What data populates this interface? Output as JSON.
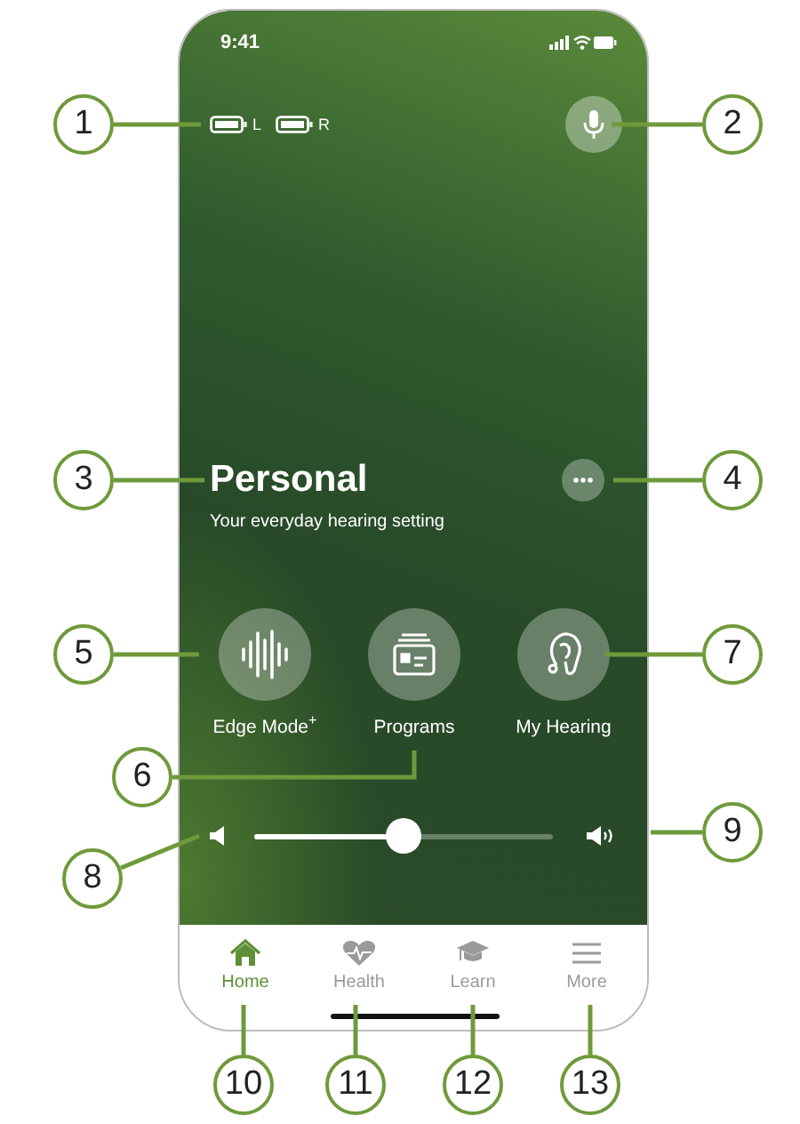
{
  "callouts": [
    "1",
    "2",
    "3",
    "4",
    "5",
    "6",
    "7",
    "8",
    "9",
    "10",
    "11",
    "12",
    "13"
  ],
  "status_bar": {
    "time": "9:41"
  },
  "hearing_aids": [
    {
      "side": "L"
    },
    {
      "side": "R"
    }
  ],
  "program": {
    "title": "Personal",
    "subtitle": "Your everyday hearing setting"
  },
  "actions": [
    {
      "kind": "edge",
      "label": "Edge Mode$^{+}$"
    },
    {
      "kind": "programs",
      "label": "Programs"
    },
    {
      "kind": "hearing",
      "label": "My Hearing"
    }
  ],
  "volume": {
    "level": 0.5
  },
  "tabs": [
    {
      "kind": "home",
      "label": "Home",
      "selected": true
    },
    {
      "kind": "health",
      "label": "Health",
      "selected": false
    },
    {
      "kind": "learn",
      "label": "Learn",
      "selected": false
    },
    {
      "kind": "more",
      "label": "More",
      "selected": false
    }
  ]
}
